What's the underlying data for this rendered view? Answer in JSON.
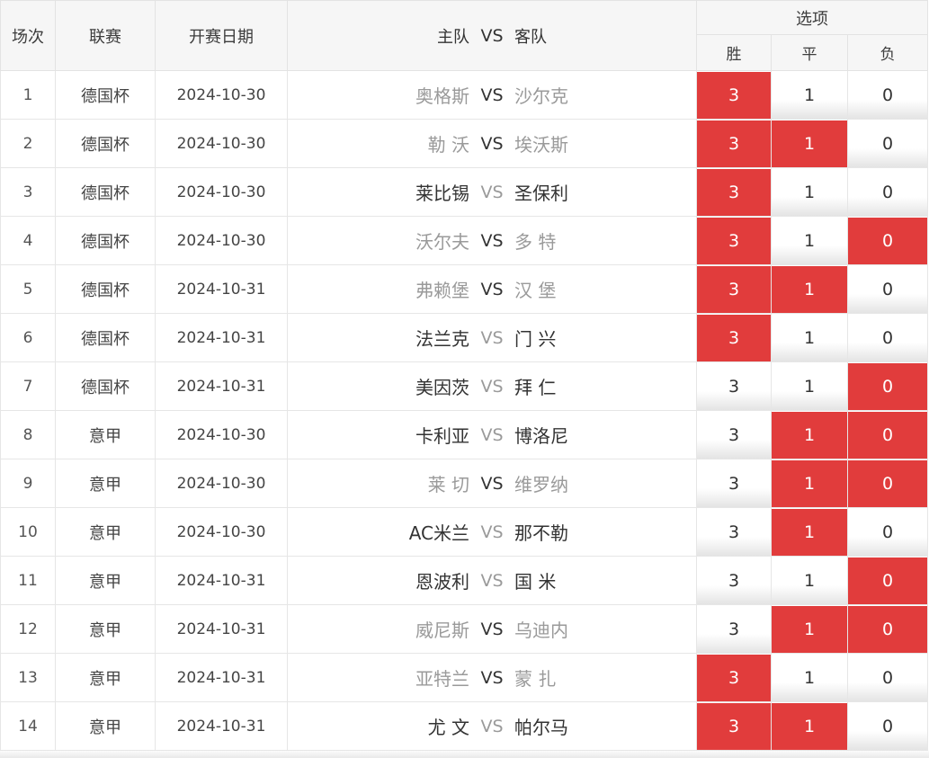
{
  "headers": {
    "index": "场次",
    "league": "联赛",
    "date": "开赛日期",
    "home": "主队",
    "vs": "VS",
    "away": "客队",
    "options": "选项",
    "win": "胜",
    "draw": "平",
    "loss": "负"
  },
  "colors": {
    "selected": "#e13c3c",
    "home_dim": "#9a9a9a"
  },
  "matches": [
    {
      "no": "1",
      "league": "德国杯",
      "date": "2024-10-30",
      "home": "奥格斯",
      "away": "沙尔克",
      "home_dim": true,
      "away_dim": true,
      "win": "3",
      "draw": "1",
      "loss": "0",
      "sel_win": true,
      "sel_draw": false,
      "sel_loss": false
    },
    {
      "no": "2",
      "league": "德国杯",
      "date": "2024-10-30",
      "home": "勒 沃",
      "away": "埃沃斯",
      "home_dim": true,
      "away_dim": true,
      "win": "3",
      "draw": "1",
      "loss": "0",
      "sel_win": true,
      "sel_draw": true,
      "sel_loss": false
    },
    {
      "no": "3",
      "league": "德国杯",
      "date": "2024-10-30",
      "home": "莱比锡",
      "away": "圣保利",
      "home_dim": false,
      "away_dim": false,
      "win": "3",
      "draw": "1",
      "loss": "0",
      "sel_win": true,
      "sel_draw": false,
      "sel_loss": false
    },
    {
      "no": "4",
      "league": "德国杯",
      "date": "2024-10-30",
      "home": "沃尔夫",
      "away": "多 特",
      "home_dim": true,
      "away_dim": true,
      "win": "3",
      "draw": "1",
      "loss": "0",
      "sel_win": true,
      "sel_draw": false,
      "sel_loss": true
    },
    {
      "no": "5",
      "league": "德国杯",
      "date": "2024-10-31",
      "home": "弗赖堡",
      "away": "汉 堡",
      "home_dim": true,
      "away_dim": true,
      "win": "3",
      "draw": "1",
      "loss": "0",
      "sel_win": true,
      "sel_draw": true,
      "sel_loss": false
    },
    {
      "no": "6",
      "league": "德国杯",
      "date": "2024-10-31",
      "home": "法兰克",
      "away": "门 兴",
      "home_dim": false,
      "away_dim": false,
      "win": "3",
      "draw": "1",
      "loss": "0",
      "sel_win": true,
      "sel_draw": false,
      "sel_loss": false
    },
    {
      "no": "7",
      "league": "德国杯",
      "date": "2024-10-31",
      "home": "美因茨",
      "away": "拜 仁",
      "home_dim": false,
      "away_dim": false,
      "win": "3",
      "draw": "1",
      "loss": "0",
      "sel_win": false,
      "sel_draw": false,
      "sel_loss": true
    },
    {
      "no": "8",
      "league": "意甲",
      "date": "2024-10-30",
      "home": "卡利亚",
      "away": "博洛尼",
      "home_dim": false,
      "away_dim": false,
      "win": "3",
      "draw": "1",
      "loss": "0",
      "sel_win": false,
      "sel_draw": true,
      "sel_loss": true
    },
    {
      "no": "9",
      "league": "意甲",
      "date": "2024-10-30",
      "home": "莱 切",
      "away": "维罗纳",
      "home_dim": true,
      "away_dim": true,
      "win": "3",
      "draw": "1",
      "loss": "0",
      "sel_win": false,
      "sel_draw": true,
      "sel_loss": true
    },
    {
      "no": "10",
      "league": "意甲",
      "date": "2024-10-30",
      "home": "AC米兰",
      "away": "那不勒",
      "home_dim": false,
      "away_dim": false,
      "win": "3",
      "draw": "1",
      "loss": "0",
      "sel_win": false,
      "sel_draw": true,
      "sel_loss": false
    },
    {
      "no": "11",
      "league": "意甲",
      "date": "2024-10-31",
      "home": "恩波利",
      "away": "国 米",
      "home_dim": false,
      "away_dim": false,
      "win": "3",
      "draw": "1",
      "loss": "0",
      "sel_win": false,
      "sel_draw": false,
      "sel_loss": true
    },
    {
      "no": "12",
      "league": "意甲",
      "date": "2024-10-31",
      "home": "威尼斯",
      "away": "乌迪内",
      "home_dim": true,
      "away_dim": true,
      "win": "3",
      "draw": "1",
      "loss": "0",
      "sel_win": false,
      "sel_draw": true,
      "sel_loss": true
    },
    {
      "no": "13",
      "league": "意甲",
      "date": "2024-10-31",
      "home": "亚特兰",
      "away": "蒙 扎",
      "home_dim": true,
      "away_dim": true,
      "win": "3",
      "draw": "1",
      "loss": "0",
      "sel_win": true,
      "sel_draw": false,
      "sel_loss": false
    },
    {
      "no": "14",
      "league": "意甲",
      "date": "2024-10-31",
      "home": "尤 文",
      "away": "帕尔马",
      "home_dim": false,
      "away_dim": false,
      "win": "3",
      "draw": "1",
      "loss": "0",
      "sel_win": true,
      "sel_draw": true,
      "sel_loss": false
    }
  ]
}
